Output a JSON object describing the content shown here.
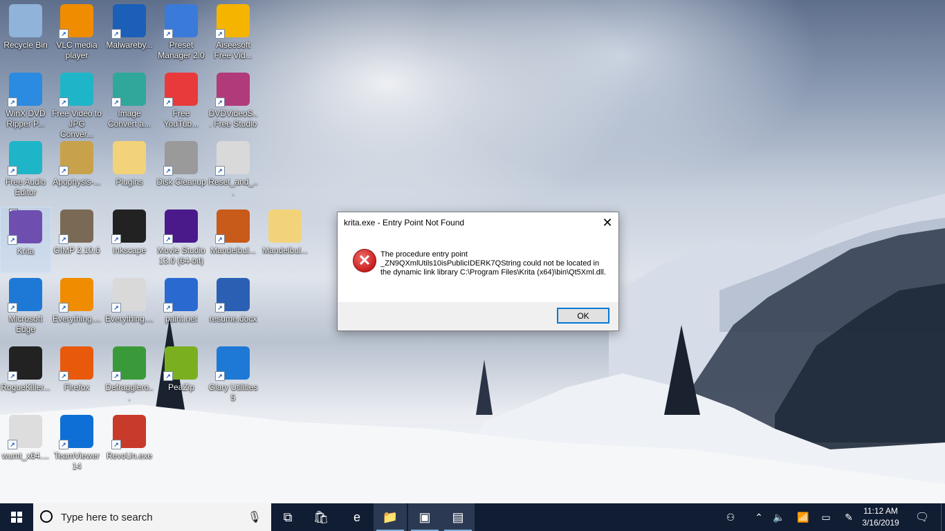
{
  "desktop_icons": [
    {
      "label": "Recycle Bin",
      "icon": "recycle-bin-icon",
      "color": "#8fb3d9"
    },
    {
      "label": "VLC media player",
      "icon": "vlc-cone-icon",
      "color": "#f08c00"
    },
    {
      "label": "Malwareby...",
      "icon": "malwarebytes-icon",
      "color": "#1b5fb8"
    },
    {
      "label": "Preset Manager 2.0",
      "icon": "preset-manager-icon",
      "color": "#3a7ad9"
    },
    {
      "label": "Aiseesoft Free Vid...",
      "icon": "aiseesoft-icon",
      "color": "#f4b400"
    },
    {
      "label": "WinX DVD Ripper P...",
      "icon": "winx-dvd-icon",
      "color": "#2a8be0"
    },
    {
      "label": "Free Video to JPG Conver...",
      "icon": "video-to-jpg-icon",
      "color": "#1fb5c8"
    },
    {
      "label": "Image Convert a...",
      "icon": "image-convert-icon",
      "color": "#2fa89a"
    },
    {
      "label": "Free YouTub...",
      "icon": "youtube-download-icon",
      "color": "#e83a3a"
    },
    {
      "label": "DVDVideoS... Free Studio",
      "icon": "free-studio-icon",
      "color": "#b13a7a"
    },
    {
      "label": "Free Audio Editor",
      "icon": "audio-editor-icon",
      "color": "#1fb5c8"
    },
    {
      "label": "Apophysis-...",
      "icon": "apophysis-icon",
      "color": "#c8a24a"
    },
    {
      "label": "Plugins",
      "icon": "folder-icon",
      "color": "#f2d37a"
    },
    {
      "label": "Disk Cleanup",
      "icon": "disk-cleanup-icon",
      "color": "#9a9a9a"
    },
    {
      "label": "Reset_and_...",
      "icon": "settings-file-icon",
      "color": "#d9d9d9"
    },
    {
      "label": "Krita",
      "icon": "krita-icon",
      "color": "#6e4fb0"
    },
    {
      "label": "GIMP 2.10.6",
      "icon": "gimp-icon",
      "color": "#7a6a55"
    },
    {
      "label": "Inkscape",
      "icon": "inkscape-icon",
      "color": "#222222"
    },
    {
      "label": "Movie Studio 13.0 (64-bit)",
      "icon": "movie-studio-icon",
      "color": "#4a1a8a"
    },
    {
      "label": "Mandelbul...",
      "icon": "mandelbulb-icon",
      "color": "#c85a1a"
    },
    {
      "label": "Mandelbul...",
      "icon": "folder-icon",
      "color": "#f2d37a"
    },
    {
      "label": "Microsoft Edge",
      "icon": "edge-icon",
      "color": "#1e78d6"
    },
    {
      "label": "Everything....",
      "icon": "everything-search-icon",
      "color": "#f08c00"
    },
    {
      "label": "Everything....",
      "icon": "settings-file-icon",
      "color": "#d9d9d9"
    },
    {
      "label": "paint.net",
      "icon": "paintnet-icon",
      "color": "#2a6ad0"
    },
    {
      "label": "resume.docx",
      "icon": "word-doc-icon",
      "color": "#2b5fb3"
    },
    {
      "label": "RogueKiller...",
      "icon": "roguekiller-icon",
      "color": "#222222"
    },
    {
      "label": "Firefox",
      "icon": "firefox-icon",
      "color": "#e8590c"
    },
    {
      "label": "Defragglero...",
      "icon": "defraggler-icon",
      "color": "#3a9a3a"
    },
    {
      "label": "PeaZip",
      "icon": "peazip-icon",
      "color": "#7ab020"
    },
    {
      "label": "Glary Utilities 5",
      "icon": "glary-icon",
      "color": "#1e78d6"
    },
    {
      "label": "wumt_x64....",
      "icon": "update-tool-icon",
      "color": "#dddddd"
    },
    {
      "label": "TeamViewer 14",
      "icon": "teamviewer-icon",
      "color": "#0e6fd6"
    },
    {
      "label": "RevoUn.exe",
      "icon": "revo-uninstaller-icon",
      "color": "#c83a2a"
    }
  ],
  "dialog": {
    "title": "krita.exe - Entry Point Not Found",
    "message": "The procedure entry point _ZN9QXmlUtils10isPublicIDERK7QString could not be located in the dynamic link library C:\\Program Files\\Krita (x64)\\bin\\Qt5Xml.dll.",
    "ok_label": "OK",
    "close_glyph": "✕",
    "error_glyph": "✕"
  },
  "taskbar": {
    "search_placeholder": "Type here to search",
    "pinned": [
      {
        "name": "task-view-icon",
        "glyph": "⧉"
      },
      {
        "name": "microsoft-store-icon",
        "glyph": "🛍"
      },
      {
        "name": "edge-icon",
        "glyph": "e"
      },
      {
        "name": "file-explorer-icon",
        "glyph": "📁"
      },
      {
        "name": "app-icon",
        "glyph": "▣"
      },
      {
        "name": "krita-error-window-icon",
        "glyph": "▤"
      }
    ],
    "time": "11:12 AM",
    "date": "3/16/2019"
  }
}
